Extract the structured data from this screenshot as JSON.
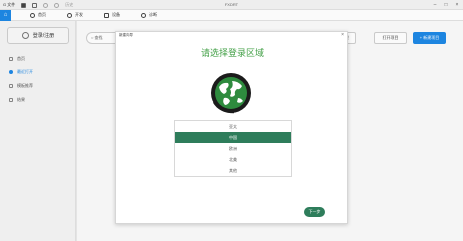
{
  "titlebar": {
    "logo": "G 文件",
    "title": "FXDRT",
    "history_label": "历史"
  },
  "menubar": {
    "items": [
      {
        "label": "首页",
        "icon": "clock-icon"
      },
      {
        "label": "开发",
        "icon": "gear-icon"
      },
      {
        "label": "设备",
        "icon": "device-icon"
      },
      {
        "label": "诊断",
        "icon": "chart-icon"
      }
    ]
  },
  "sidebar": {
    "login_label": "登录/注册",
    "items": [
      {
        "label": "首页",
        "icon": "home-icon"
      },
      {
        "label": "最近打开",
        "icon": "recent-icon"
      },
      {
        "label": "模板推荐",
        "icon": "template-icon"
      },
      {
        "label": "结果",
        "icon": "file-icon"
      }
    ]
  },
  "toolbar": {
    "search_placeholder": "查找",
    "btn_manage": "A 管理",
    "btn_open": "打开项目",
    "btn_new": "+ 新建项目"
  },
  "dialog": {
    "title": "新建向导",
    "heading": "请选择登录区域",
    "regions": [
      "亚太",
      "中国",
      "欧洲",
      "北美",
      "其他"
    ],
    "selected": "中国",
    "next_label": "下一步"
  },
  "colors": {
    "accent": "#1e88e5",
    "brand_green": "#2e7d5b",
    "heading_green": "#43a047"
  }
}
